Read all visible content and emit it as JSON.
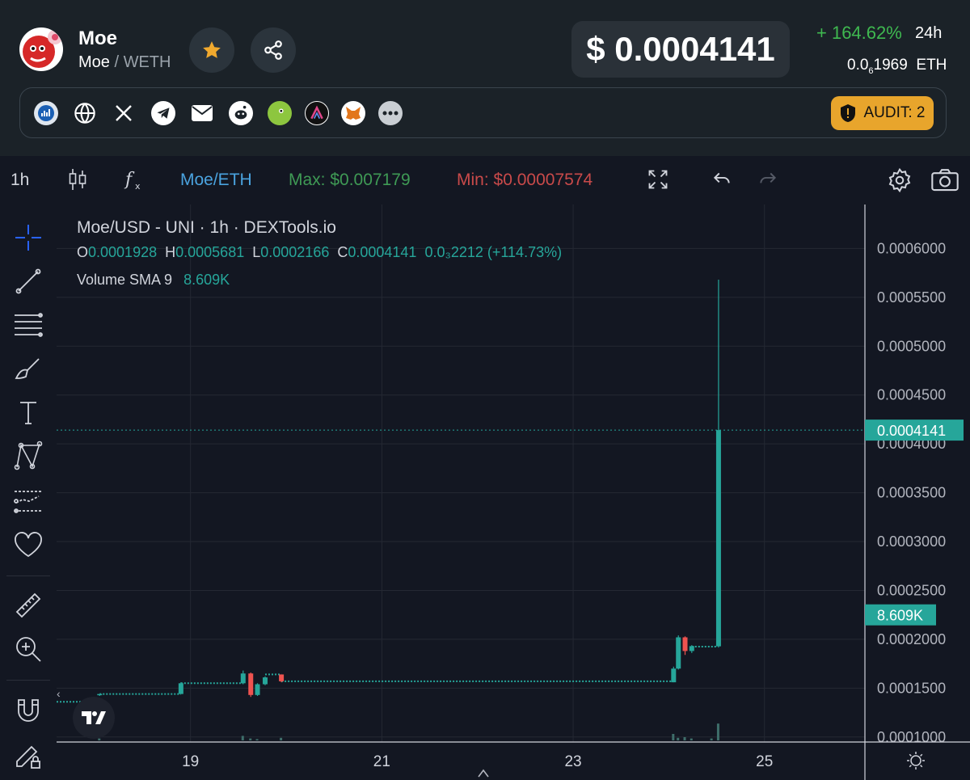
{
  "token": {
    "name": "Moe",
    "base": "Moe",
    "quote": "WETH"
  },
  "price": {
    "usd": "$ 0.0004141",
    "change": "+ 164.62%",
    "period": "24h",
    "eth_main": "0.0",
    "eth_sub": "6",
    "eth_rest": "1969",
    "eth_unit": "ETH"
  },
  "audit": {
    "label": "AUDIT: 2"
  },
  "links": [
    "chart-icon",
    "globe-icon",
    "x-icon",
    "telegram-icon",
    "mail-icon",
    "reddit-icon",
    "coingecko-icon",
    "dex-icon",
    "metamask-icon",
    "more-icon"
  ],
  "toolbar": {
    "interval": "1h",
    "pair": "Moe/ETH",
    "max_label": "Max:",
    "max_value": "$0.007179",
    "min_label": "Min:",
    "min_value": "$0.00007574"
  },
  "legend": {
    "title": "Moe/USD - UNI · 1h · DEXTools.io",
    "o_label": "O",
    "o": "0.0001928",
    "h_label": "H",
    "h": "0.0005681",
    "l_label": "L",
    "l": "0.0002166",
    "c_label": "C",
    "c": "0.0004141",
    "chg": "0.0₃2212 (+114.73%)",
    "volume_label": "Volume SMA 9",
    "volume_value": "8.609K"
  },
  "chart_data": {
    "type": "candlestick",
    "x_ticks": [
      "19",
      "21",
      "23",
      "25"
    ],
    "y_ticks": [
      "0.0006000",
      "0.0005500",
      "0.0005000",
      "0.0004500",
      "0.0004000",
      "0.0003500",
      "0.0003000",
      "0.0002500",
      "0.0002000",
      "0.0001500",
      "0.0001000"
    ],
    "ylim": [
      9.9e-05,
      0.000645
    ],
    "xlim": [
      17.6,
      26.05
    ],
    "last_price": 0.0004141,
    "last_price_label": "0.0004141",
    "volume_sma_label": "8.609K",
    "colors": {
      "up": "#26a69a",
      "down": "#ef5350",
      "grid": "#242833"
    },
    "candles": [
      {
        "t": 18.05,
        "o": 0.000143,
        "h": 0.000144,
        "l": 0.000142,
        "c": 0.000144
      },
      {
        "t": 18.9,
        "o": 0.000144,
        "h": 0.000156,
        "l": 0.000144,
        "c": 0.000155
      },
      {
        "t": 19.55,
        "o": 0.000155,
        "h": 0.000168,
        "l": 0.000154,
        "c": 0.000165
      },
      {
        "t": 19.63,
        "o": 0.000165,
        "h": 0.000166,
        "l": 0.000141,
        "c": 0.000143
      },
      {
        "t": 19.7,
        "o": 0.000143,
        "h": 0.000155,
        "l": 0.000142,
        "c": 0.000154
      },
      {
        "t": 19.78,
        "o": 0.000154,
        "h": 0.000162,
        "l": 0.000153,
        "c": 0.000161
      },
      {
        "t": 19.95,
        "o": 0.000164,
        "h": 0.000164,
        "l": 0.000156,
        "c": 0.000157
      },
      {
        "t": 24.05,
        "o": 0.000156,
        "h": 0.000172,
        "l": 0.000156,
        "c": 0.00017
      },
      {
        "t": 24.1,
        "o": 0.00017,
        "h": 0.000204,
        "l": 0.000169,
        "c": 0.000202
      },
      {
        "t": 24.17,
        "o": 0.000202,
        "h": 0.000203,
        "l": 0.000184,
        "c": 0.000188
      },
      {
        "t": 24.24,
        "o": 0.000188,
        "h": 0.000194,
        "l": 0.000186,
        "c": 0.000193
      },
      {
        "t": 24.52,
        "o": 0.0001928,
        "h": 0.0005681,
        "l": 0.0001916,
        "c": 0.0004141
      }
    ],
    "volumes": [
      {
        "t": 18.05,
        "v": 0.3
      },
      {
        "t": 19.55,
        "v": 0.7
      },
      {
        "t": 19.63,
        "v": 0.3
      },
      {
        "t": 19.7,
        "v": 0.2
      },
      {
        "t": 19.95,
        "v": 0.4
      },
      {
        "t": 24.05,
        "v": 1.0
      },
      {
        "t": 24.1,
        "v": 0.4
      },
      {
        "t": 24.17,
        "v": 0.5
      },
      {
        "t": 24.24,
        "v": 0.3
      },
      {
        "t": 24.45,
        "v": 0.3
      },
      {
        "t": 24.52,
        "v": 2.6
      }
    ]
  }
}
